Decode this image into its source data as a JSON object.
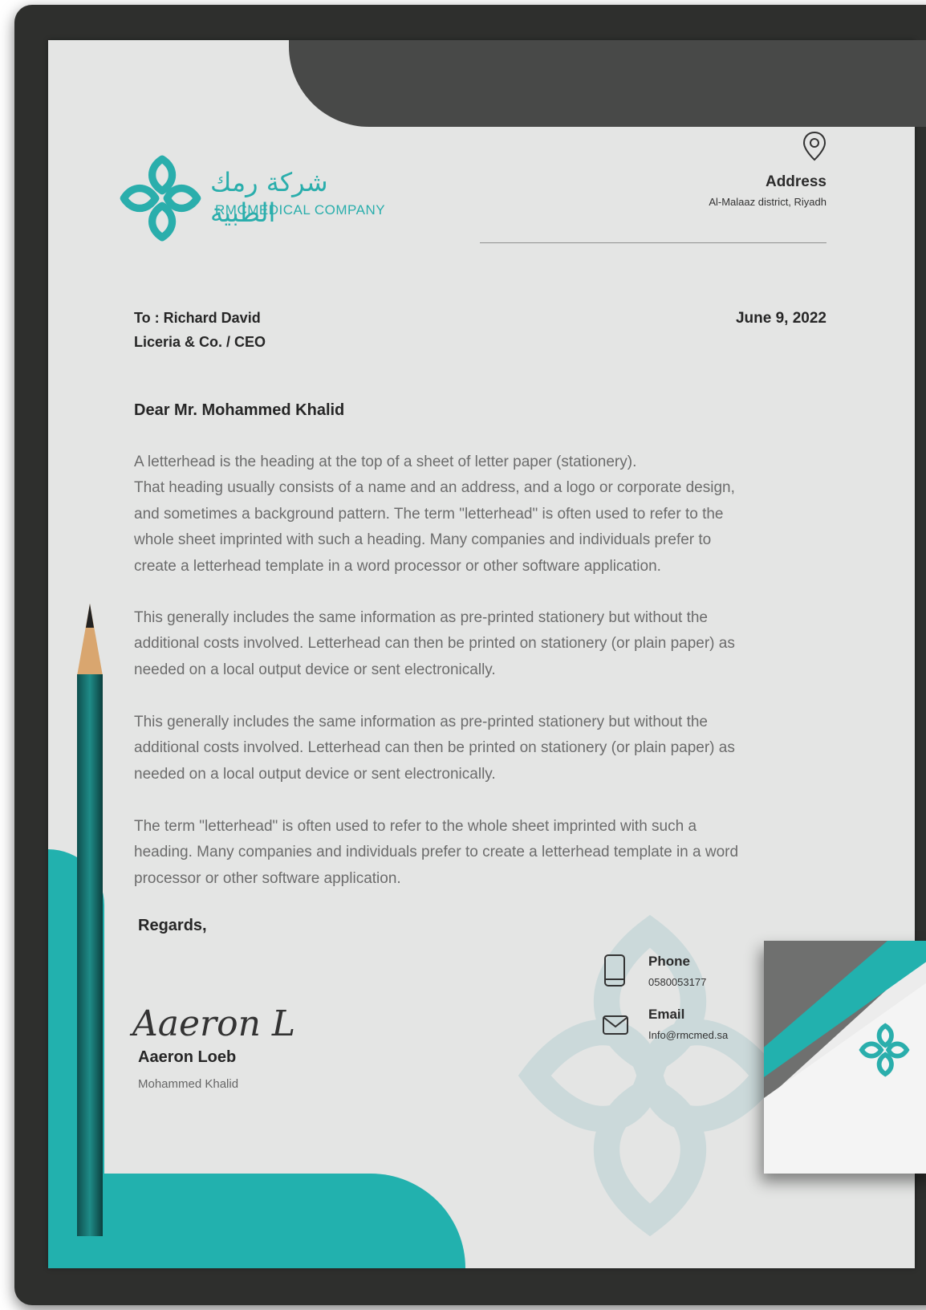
{
  "colors": {
    "accent": "#22b1ae",
    "dark": "#2e2f2d",
    "paper": "#e4e5e4"
  },
  "company": {
    "name_ar": "شركة رمك الطبية",
    "name_en": "RMCMEDICAL COMPANY"
  },
  "header": {
    "address_icon": "location-pin-icon",
    "address_title": "Address",
    "address_value": "Al-Malaaz district, Riyadh"
  },
  "recipient": {
    "line1": "To : Richard David",
    "line2": "Liceria & Co. / CEO"
  },
  "date": "June 9, 2022",
  "salutation": "Dear Mr. Mohammed Khalid",
  "paragraphs": [
    "A letterhead is the heading at the top of a sheet of letter paper (stationery).\nThat heading usually consists of a name and an address, and a logo or corporate design,\nand sometimes a background pattern. The term \"letterhead\" is often used to refer to the\nwhole sheet imprinted with such a heading. Many companies and individuals prefer to\ncreate a letterhead template in a word processor or other software application.",
    "This generally includes the same information as pre-printed stationery but without the\nadditional costs involved. Letterhead can then be printed on stationery (or plain paper) as\nneeded on a local output device or sent electronically.",
    "This generally includes the same information as pre-printed stationery but without the\nadditional costs involved. Letterhead can then be printed on stationery (or plain paper) as\nneeded on a local output device or sent electronically.",
    "The term \"letterhead\" is often used to refer to the whole sheet imprinted with such a\nheading. Many companies and individuals prefer to create a letterhead template in a word\nprocessor or other software application."
  ],
  "closing": {
    "regards": "Regards,",
    "signature_text": "Aaeron L",
    "signer_name": "Aaeron Loeb",
    "signer_title": "Mohammed Khalid"
  },
  "contact": {
    "phone_label": "Phone",
    "phone_value": "0580053177",
    "phone_icon": "phone-icon",
    "email_label": "Email",
    "email_value": "Info@rmcmed.sa",
    "email_icon": "envelope-icon"
  }
}
